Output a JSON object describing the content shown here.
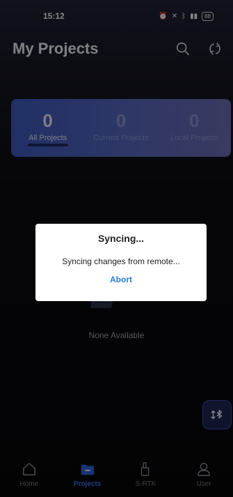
{
  "status_bar": {
    "time": "15:12",
    "indicators": "⏰ ⚑ ✱   KB/S",
    "network": "4G 4G",
    "battery": "88"
  },
  "header": {
    "title": "My Projects"
  },
  "stats": [
    {
      "count": "0",
      "label": "All Projects",
      "active": true
    },
    {
      "count": "0",
      "label": "Current Projects",
      "active": false
    },
    {
      "count": "0",
      "label": "Local Projects",
      "active": false
    }
  ],
  "empty_state": {
    "text": "None Available"
  },
  "dialog": {
    "title": "Syncing...",
    "message": "Syncing changes from remote...",
    "action": "Abort"
  },
  "bottom_nav": [
    {
      "label": "Home",
      "icon": "home-icon",
      "active": false
    },
    {
      "label": "Projects",
      "icon": "folder-icon",
      "active": true
    },
    {
      "label": "S-RTK",
      "icon": "antenna-icon",
      "active": false
    },
    {
      "label": "User",
      "icon": "user-icon",
      "active": false
    }
  ],
  "colors": {
    "accent": "#3a6ee8",
    "dialog_action": "#2a7fd4",
    "card_start": "#3e5bc2",
    "card_end": "#6d6fb7"
  }
}
